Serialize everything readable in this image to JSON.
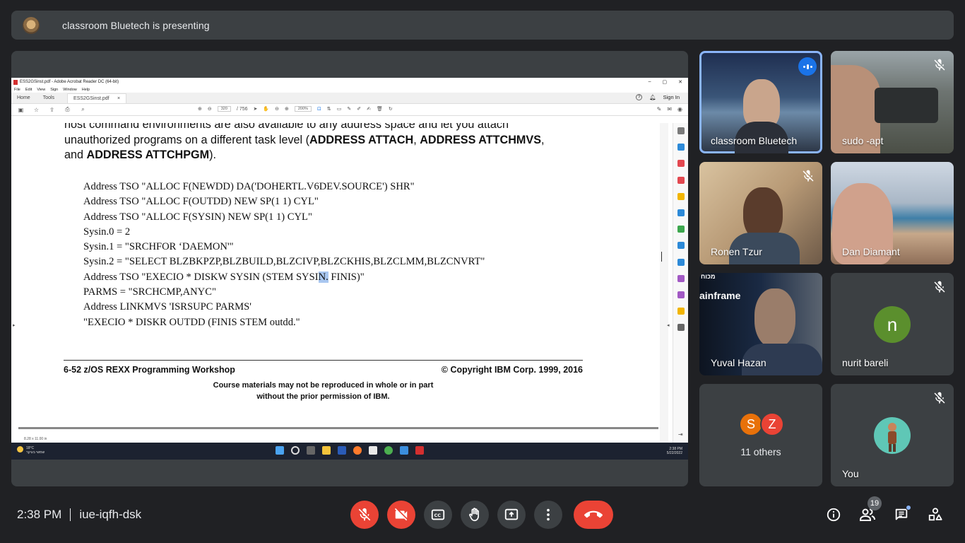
{
  "banner": {
    "text": "classroom Bluetech is presenting"
  },
  "acrobat": {
    "window_title": "ESS2GSinst.pdf - Adobe Acrobat Reader DC (64-bit)",
    "window_controls": [
      "–",
      "▢",
      "✕"
    ],
    "menu": [
      "File",
      "Edit",
      "View",
      "Sign",
      "Window",
      "Help"
    ],
    "tabs": {
      "home": "Home",
      "tools": "Tools",
      "file": "ESS2GSinst.pdf",
      "close": "×"
    },
    "sign_in": "Sign In",
    "page_number": "320",
    "page_total": "/ 756",
    "zoom": "200%",
    "page_size": "8.28 x 11.00 in"
  },
  "document": {
    "intro_line1": "host command environments are also available to any address space and let you attach",
    "intro_line2_a": "unauthorized programs on a different task level (",
    "intro_b1": "ADDRESS ATTACH",
    "intro_sep1": ", ",
    "intro_b2": "ADDRESS ATTCHMVS",
    "intro_sep2": ",",
    "intro_line3_a": "and ",
    "intro_b3": "ADDRESS ATTCHPGM",
    "intro_line3_end": ").",
    "code": [
      "Address TSO \"ALLOC F(NEWDD) DA('DOHERTL.V6DEV.SOURCE') SHR\"",
      "Address TSO \"ALLOC F(OUTDD) NEW SP(1 1) CYL\"",
      "Address TSO \"ALLOC F(SYSIN) NEW SP(1 1) CYL\"",
      "Sysin.0 = 2",
      "Sysin.1 = \"SRCHFOR ‘DAEMON'\"",
      "Sysin.2 = \"SELECT BLZBKPZP,BLZBUILD,BLZCIVP,BLZCKHIS,BLZCLMM,BLZCNVRT\"",
      "PARMS = \"SRCHCMP,ANYC\"",
      "Address LINKMVS 'ISRSUPC PARMS'",
      "\"EXECIO * DISKR OUTDD (FINIS STEM outdd.\""
    ],
    "code_execio_pre": "Address TSO \"EXECIO * DISKW SYSIN (STEM SYSI",
    "code_execio_hl": "N.",
    "code_execio_post": " FINIS)\"",
    "footer_left": "6-52  z/OS REXX Programming Workshop",
    "footer_right": "© Copyright IBM Corp. 1999, 2016",
    "notice_line1": "Course materials may not be reproduced in whole or in part",
    "notice_line2": "without the prior permission of IBM."
  },
  "taskbar": {
    "weather_temp": "18°C",
    "weather_text": "שמשי בעיקר",
    "time": "2:38 PM",
    "date": "5/22/2022"
  },
  "participants": [
    {
      "name": "classroom Bluetech",
      "speaking": true
    },
    {
      "name": "sudo -apt",
      "muted": true
    },
    {
      "name": "Ronen Tzur",
      "muted": true
    },
    {
      "name": "Dan Diamant"
    },
    {
      "name": "Yuval Hazan",
      "overlay_text": "ainframe",
      "overlay_text_top": "מכוח"
    },
    {
      "name": "nurit bareli",
      "initial": "n",
      "muted": true
    },
    {
      "others_label": "11 others",
      "initials": [
        "S",
        "Z"
      ]
    },
    {
      "name": "You",
      "muted": true
    }
  ],
  "bottom": {
    "time": "2:38 PM",
    "meeting_code": "iue-iqfh-dsk",
    "people_count": "19"
  },
  "colors": {
    "accent": "#8ab4f8",
    "danger": "#ea4335",
    "surface": "#3c4043",
    "background": "#202124",
    "avatar_n": "#5b8f2d",
    "avatar_s": "#e8710a",
    "avatar_z": "#ea4335"
  }
}
